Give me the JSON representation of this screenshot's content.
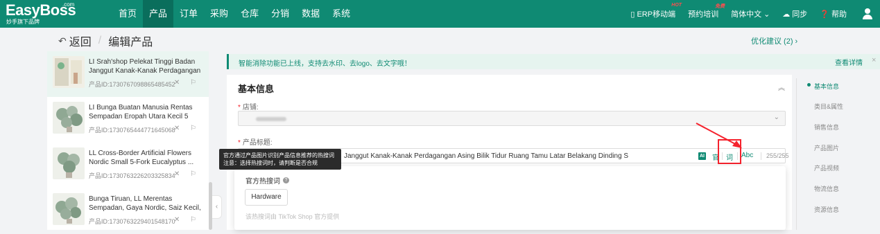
{
  "header": {
    "logo": "EasyBoss",
    "logo_com": ".com",
    "logo_sub": "妙手旗下品牌",
    "nav": [
      "首页",
      "产品",
      "订单",
      "采购",
      "仓库",
      "分销",
      "数据",
      "系统"
    ],
    "active_nav": "产品",
    "right": {
      "erp_mobile": "ERP移动端",
      "erp_badge": "HOT",
      "training": "预约培训",
      "training_badge": "免费",
      "language": "简体中文",
      "language_arrow": "⌄",
      "sync": "同步",
      "help": "帮助"
    }
  },
  "breadcrumb": {
    "back": "返回",
    "separator": "/",
    "current": "编辑产品"
  },
  "suggest": "优化建议 (2) ›",
  "products": [
    {
      "name": "LI Srah'shop Pelekat Tinggi Badan Janggut Kanak-Kanak Perdagangan ...",
      "id": "产品ID:1730767098865485452",
      "active": true
    },
    {
      "name": "LI Bunga Buatan Manusia Rentas Sempadan Eropah Utara Kecil 5 Sali...",
      "id": "产品ID:1730765444771645068",
      "active": false
    },
    {
      "name": "LL Cross-Border Artificial Flowers Nordic Small 5-Fork Eucalyptus ...",
      "id": "产品ID:1730763226203325834",
      "active": false
    },
    {
      "name": "Bunga Tiruan, LL Merentas Sempadan, Gaya Nordic, Saiz Kecil, 5 Garpu, Da...",
      "id": "产品ID:1730763229401548170",
      "active": false
    }
  ],
  "product_actions": "✕ ⚐",
  "notice": {
    "text": "智能消除功能已上线，支持去水印、去logo、去文字哦！",
    "link": "查看详情",
    "close": "×"
  },
  "basic_info": {
    "title": "基本信息",
    "toggle": "︽",
    "store_label": "店铺:",
    "store_arrow": "⌄",
    "title_label": "产品标题:",
    "title_value": "Janggut Kanak-Kanak Perdagangan Asing Bilik Tidur Ruang Tamu Latar Belakang Dinding S",
    "ai": "AI",
    "tool_official": "官",
    "tool_word": "词",
    "tool_abc": "Abc",
    "counter": "255/255"
  },
  "hot_words": {
    "title": "官方热搜词",
    "help": "?",
    "keyword": "Hardware",
    "source": "该热搜词由 TikTok Shop 官方提供"
  },
  "tooltip": {
    "line1": "官方通过产品图片识别产品信息推荐的热搜词",
    "line2": "注意：选择热搜词时，请判断是否合规"
  },
  "anchors": [
    "基本信息",
    "类目&属性",
    "销售信息",
    "产品图片",
    "产品视频",
    "物流信息",
    "资源信息"
  ],
  "colors": {
    "brand": "#0f8a73",
    "highlight": "#f5222d"
  }
}
